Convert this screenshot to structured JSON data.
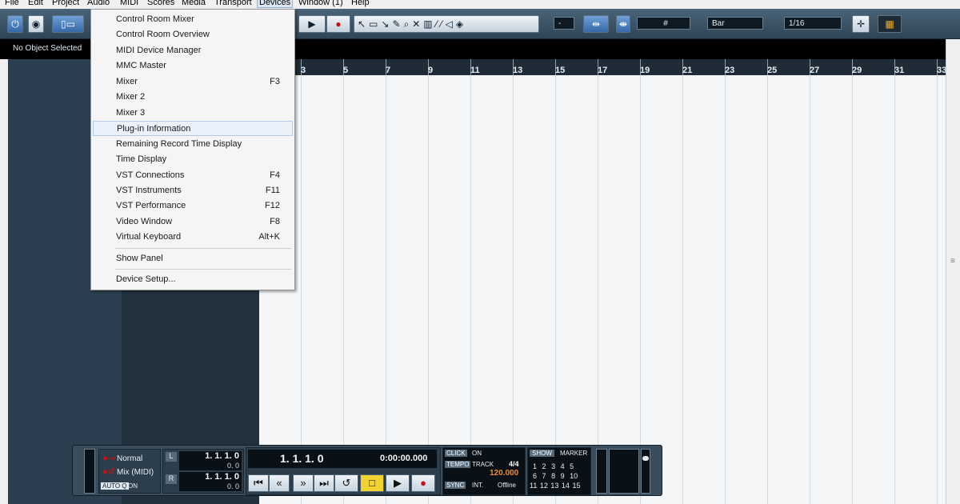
{
  "menubar": {
    "items": [
      "File",
      "Edit",
      "Project",
      "Audio",
      "MIDI",
      "Scores",
      "Media",
      "Transport",
      "Devices",
      "Window (1)",
      "Help"
    ],
    "active": "Devices"
  },
  "toolbar": {
    "quantize_value": "1/16",
    "grid_type": "Bar",
    "snap_field": "-",
    "grid_symbol": "#"
  },
  "infobar": {
    "status": "No Object Selected"
  },
  "ruler": {
    "bars": [
      "3",
      "5",
      "7",
      "9",
      "11",
      "13",
      "15",
      "17",
      "19",
      "21",
      "23",
      "25",
      "27",
      "29",
      "31",
      "33"
    ]
  },
  "devices_menu": {
    "items": [
      {
        "label": "Control Room Mixer",
        "shortcut": ""
      },
      {
        "label": "Control Room Overview",
        "shortcut": ""
      },
      {
        "label": "MIDI Device Manager",
        "shortcut": ""
      },
      {
        "label": "MMC Master",
        "shortcut": ""
      },
      {
        "label": "Mixer",
        "shortcut": "F3"
      },
      {
        "label": "Mixer 2",
        "shortcut": ""
      },
      {
        "label": "Mixer 3",
        "shortcut": ""
      },
      {
        "label": "Plug-in Information",
        "shortcut": ""
      },
      {
        "label": "Remaining Record Time Display",
        "shortcut": ""
      },
      {
        "label": "Time Display",
        "shortcut": ""
      },
      {
        "label": "VST Connections",
        "shortcut": "F4"
      },
      {
        "label": "VST Instruments",
        "shortcut": "F11"
      },
      {
        "label": "VST Performance",
        "shortcut": "F12"
      },
      {
        "label": "Video Window",
        "shortcut": "F8"
      },
      {
        "label": "Virtual Keyboard",
        "shortcut": "Alt+K"
      },
      {
        "label": "Show Panel",
        "shortcut": ""
      },
      {
        "label": "Device Setup...",
        "shortcut": ""
      }
    ],
    "highlighted": "Plug-in Information"
  },
  "transport": {
    "mode_normal": "Normal",
    "mode_mix": "Mix (MIDI)",
    "autoq": "AUTO Q",
    "autoq_state": "ON",
    "left_locator": "1. 1. 1.   0",
    "left_sub": "0.   0",
    "right_locator": "1. 1. 1.   0",
    "right_sub": "0.   0",
    "locator_l": "L",
    "locator_r": "R",
    "position_bars": "1. 1. 1.   0",
    "position_time": "0:00:00.000",
    "click_label": "CLICK",
    "click_state": "ON",
    "tempo_label": "TEMPO",
    "tempo_mode": "TRACK",
    "signature": "4/4",
    "tempo_value": "120.000",
    "sync_label": "SYNC",
    "sync_source": "INT.",
    "sync_state": "Offline",
    "show_label": "SHOW",
    "marker_label": "MARKER",
    "markers_row1": [
      "1",
      "2",
      "3",
      "4",
      "5"
    ],
    "markers_row2": [
      "6",
      "7",
      "8",
      "9",
      "10"
    ],
    "markers_row3": [
      "11",
      "12",
      "13",
      "14",
      "15"
    ]
  }
}
